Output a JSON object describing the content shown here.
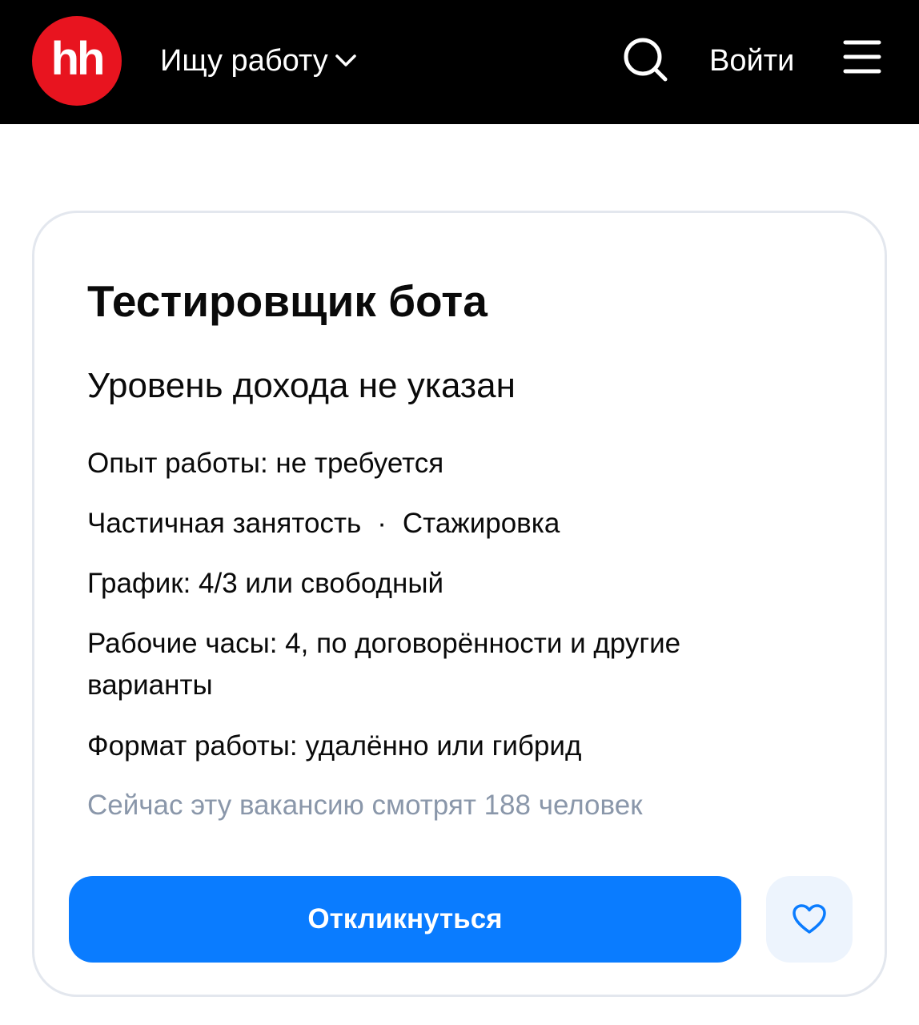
{
  "header": {
    "logo_text": "hh",
    "mode_label": "Ищу работу",
    "login_label": "Войти",
    "icons": {
      "mode_chevron": "chevron-down-icon",
      "search": "search-icon",
      "menu": "hamburger-menu-icon"
    },
    "colors": {
      "background": "#000000",
      "logo": "#e8141f"
    }
  },
  "vacancy": {
    "title": "Тестировщик бота",
    "salary": "Уровень дохода не указан",
    "experience": "Опыт работы: не требуется",
    "employment": {
      "type": "Частичная занятость",
      "separator": "·",
      "kind": "Стажировка"
    },
    "schedule": "График: 4/3 или свободный",
    "hours": "Рабочие часы: 4, по договорённости и другие варианты",
    "format": "Формат работы: удалённо или гибрид",
    "viewers": "Сейчас эту вакансию смотрят 188 человек"
  },
  "actions": {
    "apply_label": "Откликнуться",
    "favorite_icon": "heart-icon",
    "colors": {
      "apply": "#0a7cff",
      "favorite_bg": "#edf4fd",
      "favorite_icon": "#0a7cff"
    }
  }
}
